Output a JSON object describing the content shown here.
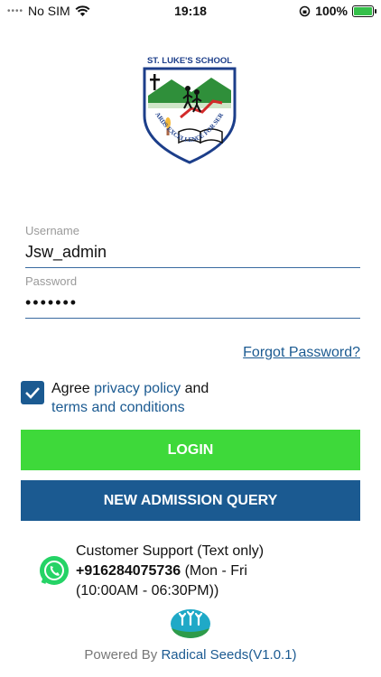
{
  "status_bar": {
    "carrier": "No SIM",
    "time": "19:18",
    "battery": "100%",
    "battery_level": 1.0
  },
  "logo": {
    "school_name": "ST. LUKE'S SCHOOL",
    "motto": "TOWARDS EXCELLENCE FOR SERVICE"
  },
  "form": {
    "username_label": "Username",
    "username_value": "Jsw_admin",
    "password_label": "Password",
    "password_value": "•••••••"
  },
  "forgot_password": "Forgot Password?",
  "agree": {
    "text_prefix": "Agree ",
    "privacy_link": "privacy policy",
    "and_text": " and",
    "terms_link": "terms and conditions",
    "checked": true
  },
  "buttons": {
    "login": "LOGIN",
    "admission": "NEW ADMISSION QUERY"
  },
  "support": {
    "line1": "Customer Support (Text only)",
    "phone": "+916284075736",
    "hours_a": " (Mon - Fri",
    "hours_b": "(10:00AM - 06:30PM))"
  },
  "footer": {
    "powered_by": "Powered By ",
    "company": "Radical Seeds(V1.0.1)"
  },
  "colors": {
    "primary": "#1b5a91",
    "login_green": "#3ed93a",
    "whatsapp": "#25d366"
  }
}
